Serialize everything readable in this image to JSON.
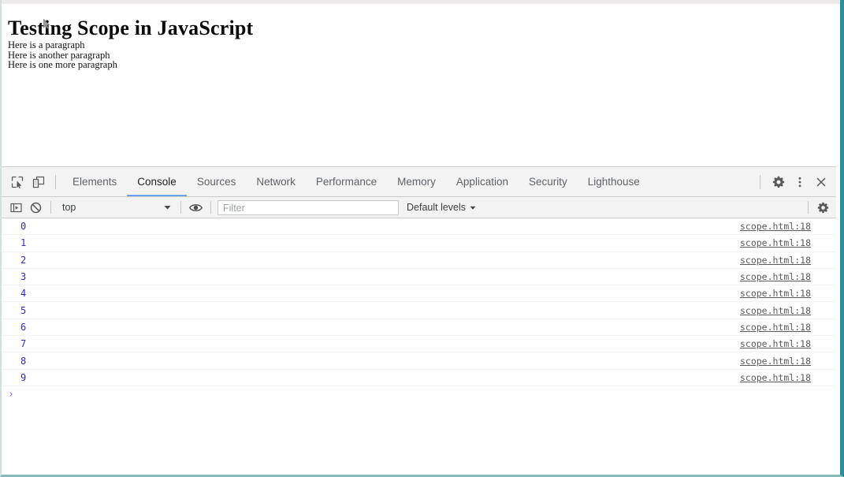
{
  "webpage": {
    "heading": "Testing Scope in JavaScript",
    "paragraphs": [
      "Here is a paragraph",
      "Here is another paragraph",
      "Here is one more paragraph"
    ]
  },
  "devtools": {
    "left_icons": [
      {
        "name": "inspect-element-icon"
      },
      {
        "name": "device-toolbar-icon"
      }
    ],
    "tabs": [
      {
        "label": "Elements",
        "selected": false
      },
      {
        "label": "Console",
        "selected": true
      },
      {
        "label": "Sources",
        "selected": false
      },
      {
        "label": "Network",
        "selected": false
      },
      {
        "label": "Performance",
        "selected": false
      },
      {
        "label": "Memory",
        "selected": false
      },
      {
        "label": "Application",
        "selected": false
      },
      {
        "label": "Security",
        "selected": false
      },
      {
        "label": "Lighthouse",
        "selected": false
      }
    ],
    "right_icons": [
      {
        "name": "settings-gear-icon"
      },
      {
        "name": "more-options-icon"
      },
      {
        "name": "close-icon"
      }
    ],
    "active_tab_underline_color": "#6ba4e7",
    "console_toolbar": {
      "sidebar_toggle_icon": "console-sidebar-icon",
      "clear_console_icon": "clear-console-icon",
      "context_value": "top",
      "context_dropdown_icon": "chevron-down-icon",
      "live_expression_icon": "eye-icon",
      "filter_placeholder": "Filter",
      "filter_value": "",
      "levels_label": "Default levels",
      "levels_dropdown_icon": "chevron-down-icon",
      "settings_icon": "console-settings-gear-icon"
    },
    "console_logs": [
      {
        "message": "0",
        "source": "scope.html:18"
      },
      {
        "message": "1",
        "source": "scope.html:18"
      },
      {
        "message": "2",
        "source": "scope.html:18"
      },
      {
        "message": "3",
        "source": "scope.html:18"
      },
      {
        "message": "4",
        "source": "scope.html:18"
      },
      {
        "message": "5",
        "source": "scope.html:18"
      },
      {
        "message": "6",
        "source": "scope.html:18"
      },
      {
        "message": "7",
        "source": "scope.html:18"
      },
      {
        "message": "8",
        "source": "scope.html:18"
      },
      {
        "message": "9",
        "source": "scope.html:18"
      }
    ],
    "prompt_chevron": "›",
    "log_text_color": "#2a2aca",
    "source_link_color": "#5a5a5a"
  },
  "frame": {
    "right_border_color": "#2e8e9c",
    "bottom_border_color": "#89b9b8"
  }
}
